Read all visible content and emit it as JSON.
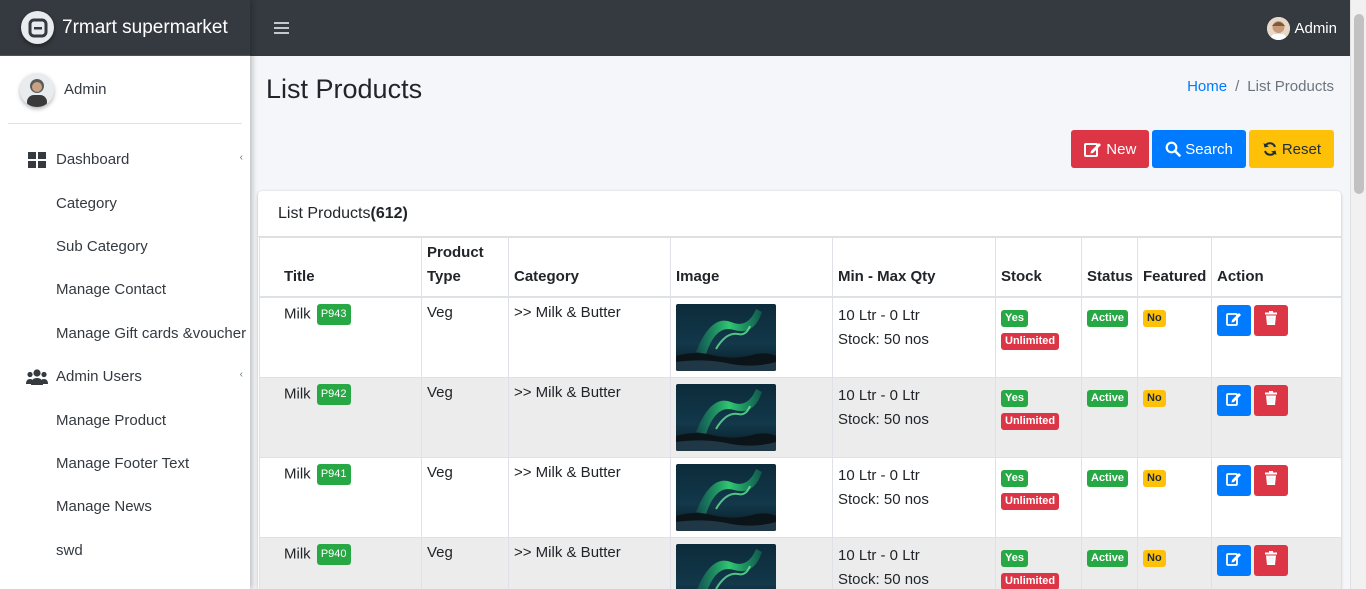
{
  "brand": {
    "name": "7rmart supermarket"
  },
  "sidebar": {
    "user_name": "Admin",
    "items": [
      {
        "label": "Dashboard",
        "type": "top",
        "icon": "dashboard-icon",
        "caret": true
      },
      {
        "label": "Category",
        "type": "sub"
      },
      {
        "label": "Sub Category",
        "type": "sub"
      },
      {
        "label": "Manage Contact",
        "type": "sub"
      },
      {
        "label": "Manage Gift cards &voucher",
        "type": "sub"
      },
      {
        "label": "Admin Users",
        "type": "top",
        "icon": "users-icon",
        "caret": true
      },
      {
        "label": "Manage Product",
        "type": "sub"
      },
      {
        "label": "Manage Footer Text",
        "type": "sub"
      },
      {
        "label": "Manage News",
        "type": "sub"
      },
      {
        "label": "swd",
        "type": "sub"
      }
    ]
  },
  "navbar": {
    "user_label": "Admin"
  },
  "page": {
    "title": "List Products",
    "breadcrumb": {
      "home": "Home",
      "separator": "/",
      "current": "List Products"
    }
  },
  "toolbar": {
    "new_label": "New",
    "search_label": "Search",
    "reset_label": "Reset"
  },
  "card": {
    "title": "List Products",
    "count": "(612)"
  },
  "table": {
    "headers": [
      "Title",
      "Product Type",
      "Category",
      "Image",
      "Min - Max Qty",
      "Stock",
      "Status",
      "Featured",
      "Action"
    ],
    "rows": [
      {
        "title": "Milk",
        "code": "P943",
        "type": "Veg",
        "category": ">> Milk & Butter",
        "qty": "10 Ltr - 0 Ltr",
        "stock_text": "Stock: 50 nos",
        "stock": "Yes",
        "stock_limit": "Unlimited",
        "status": "Active",
        "featured": "No"
      },
      {
        "title": "Milk",
        "code": "P942",
        "type": "Veg",
        "category": ">> Milk & Butter",
        "qty": "10 Ltr - 0 Ltr",
        "stock_text": "Stock: 50 nos",
        "stock": "Yes",
        "stock_limit": "Unlimited",
        "status": "Active",
        "featured": "No"
      },
      {
        "title": "Milk",
        "code": "P941",
        "type": "Veg",
        "category": ">> Milk & Butter",
        "qty": "10 Ltr - 0 Ltr",
        "stock_text": "Stock: 50 nos",
        "stock": "Yes",
        "stock_limit": "Unlimited",
        "status": "Active",
        "featured": "No"
      },
      {
        "title": "Milk",
        "code": "P940",
        "type": "Veg",
        "category": ">> Milk & Butter",
        "qty": "10 Ltr - 0 Ltr",
        "stock_text": "Stock: 50 nos",
        "stock": "Yes",
        "stock_limit": "Unlimited",
        "status": "Active",
        "featured": "No"
      }
    ]
  },
  "colors": {
    "navbar_bg": "#343a40",
    "primary": "#007bff",
    "danger": "#dc3545",
    "warning": "#ffc107",
    "success": "#28a745"
  }
}
